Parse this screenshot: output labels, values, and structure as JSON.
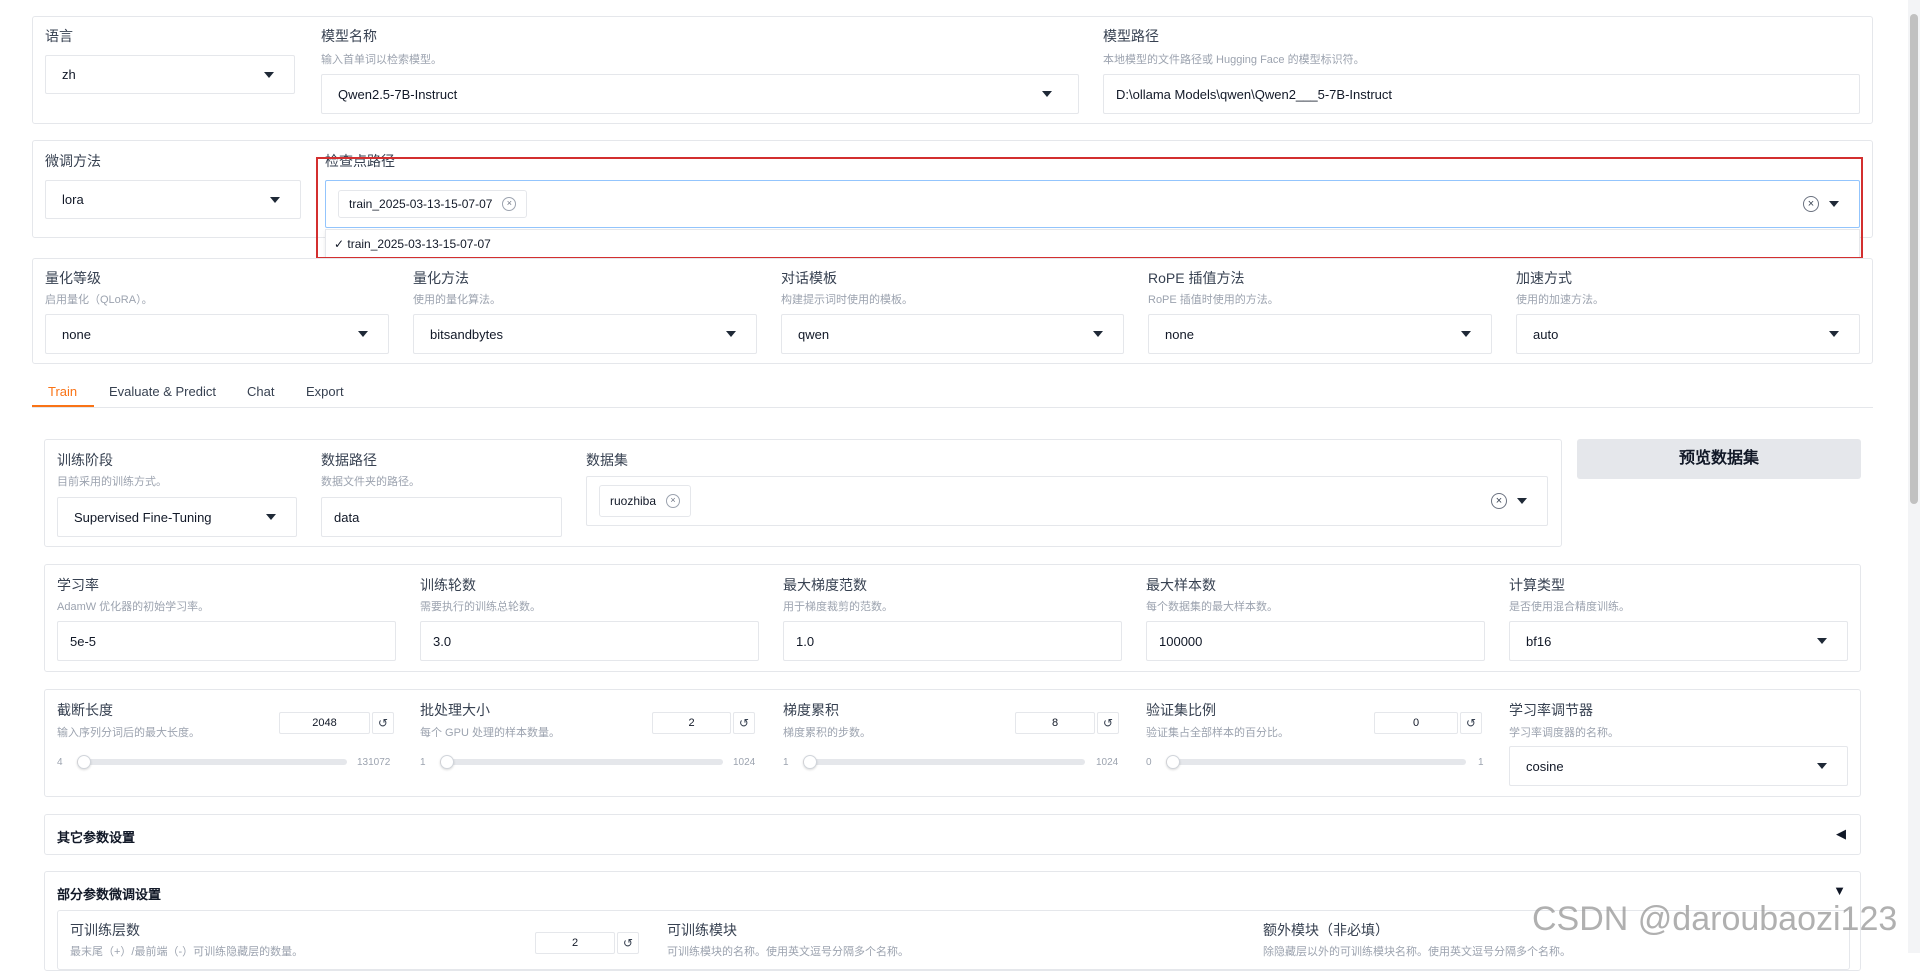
{
  "top": {
    "language": {
      "label": "语言",
      "value": "zh"
    },
    "model_name": {
      "label": "模型名称",
      "hint": "输入首单词以检索模型。",
      "value": "Qwen2.5-7B-Instruct"
    },
    "model_path": {
      "label": "模型路径",
      "hint": "本地模型的文件路径或 Hugging Face 的模型标识符。",
      "value": "D:\\ollama Models\\qwen\\Qwen2___5-7B-Instruct"
    }
  },
  "finetune": {
    "method": {
      "label": "微调方法",
      "value": "lora"
    },
    "checkpoint": {
      "label": "检查点路径",
      "chip": "train_2025-03-13-15-07-07",
      "option": "✓ train_2025-03-13-15-07-07"
    }
  },
  "quant": {
    "level": {
      "label": "量化等级",
      "hint": "启用量化（QLoRA）。",
      "value": "none"
    },
    "method": {
      "label": "量化方法",
      "hint": "使用的量化算法。",
      "value": "bitsandbytes"
    },
    "template": {
      "label": "对话模板",
      "hint": "构建提示词时使用的模板。",
      "value": "qwen"
    },
    "rope": {
      "label": "RoPE 插值方法",
      "hint": "RoPE 插值时使用的方法。",
      "value": "none"
    },
    "accel": {
      "label": "加速方式",
      "hint": "使用的加速方法。",
      "value": "auto"
    }
  },
  "tabs": [
    "Train",
    "Evaluate & Predict",
    "Chat",
    "Export"
  ],
  "train": {
    "stage": {
      "label": "训练阶段",
      "hint": "目前采用的训练方式。",
      "value": "Supervised Fine-Tuning"
    },
    "data_dir": {
      "label": "数据路径",
      "hint": "数据文件夹的路径。",
      "value": "data"
    },
    "dataset": {
      "label": "数据集",
      "chip": "ruozhiba"
    },
    "preview_btn": "预览数据集"
  },
  "params": {
    "lr": {
      "label": "学习率",
      "hint": "AdamW 优化器的初始学习率。",
      "value": "5e-5"
    },
    "epochs": {
      "label": "训练轮数",
      "hint": "需要执行的训练总轮数。",
      "value": "3.0"
    },
    "max_grad": {
      "label": "最大梯度范数",
      "hint": "用于梯度裁剪的范数。",
      "value": "1.0"
    },
    "max_samples": {
      "label": "最大样本数",
      "hint": "每个数据集的最大样本数。",
      "value": "100000"
    },
    "compute": {
      "label": "计算类型",
      "hint": "是否使用混合精度训练。",
      "value": "bf16"
    }
  },
  "sliders": {
    "cutoff": {
      "label": "截断长度",
      "hint": "输入序列分词后的最大长度。",
      "value": "2048",
      "min": "4",
      "max": "131072",
      "level": 0.015
    },
    "batch": {
      "label": "批处理大小",
      "hint": "每个 GPU 处理的样本数量。",
      "value": "2",
      "min": "1",
      "max": "1024",
      "level": 0.001
    },
    "grad_acc": {
      "label": "梯度累积",
      "hint": "梯度累积的步数。",
      "value": "8",
      "min": "1",
      "max": "1024",
      "level": 0.007
    },
    "val": {
      "label": "验证集比例",
      "hint": "验证集占全部样本的百分比。",
      "value": "0",
      "min": "0",
      "max": "1",
      "level": 0
    },
    "scheduler": {
      "label": "学习率调节器",
      "hint": "学习率调度器的名称。",
      "value": "cosine"
    }
  },
  "accordions": {
    "other": {
      "label": "其它参数设置",
      "icon": "◀"
    },
    "partial": {
      "label": "部分参数微调设置",
      "icon": "▼"
    }
  },
  "partial": {
    "layers": {
      "label": "可训练层数",
      "hint": "最末尾（+）/最前端（-）可训练隐藏层的数量。",
      "value": "2"
    },
    "modules": {
      "label": "可训练模块",
      "hint": "可训练模块的名称。使用英文逗号分隔多个名称。"
    },
    "extra": {
      "label": "额外模块（非必填）",
      "hint": "除隐藏层以外的可训练模块名称。使用英文逗号分隔多个名称。"
    }
  },
  "watermark": "CSDN @daroubaozi123",
  "colors": {
    "accent": "#f97316",
    "highlight": "#d32f2f"
  }
}
